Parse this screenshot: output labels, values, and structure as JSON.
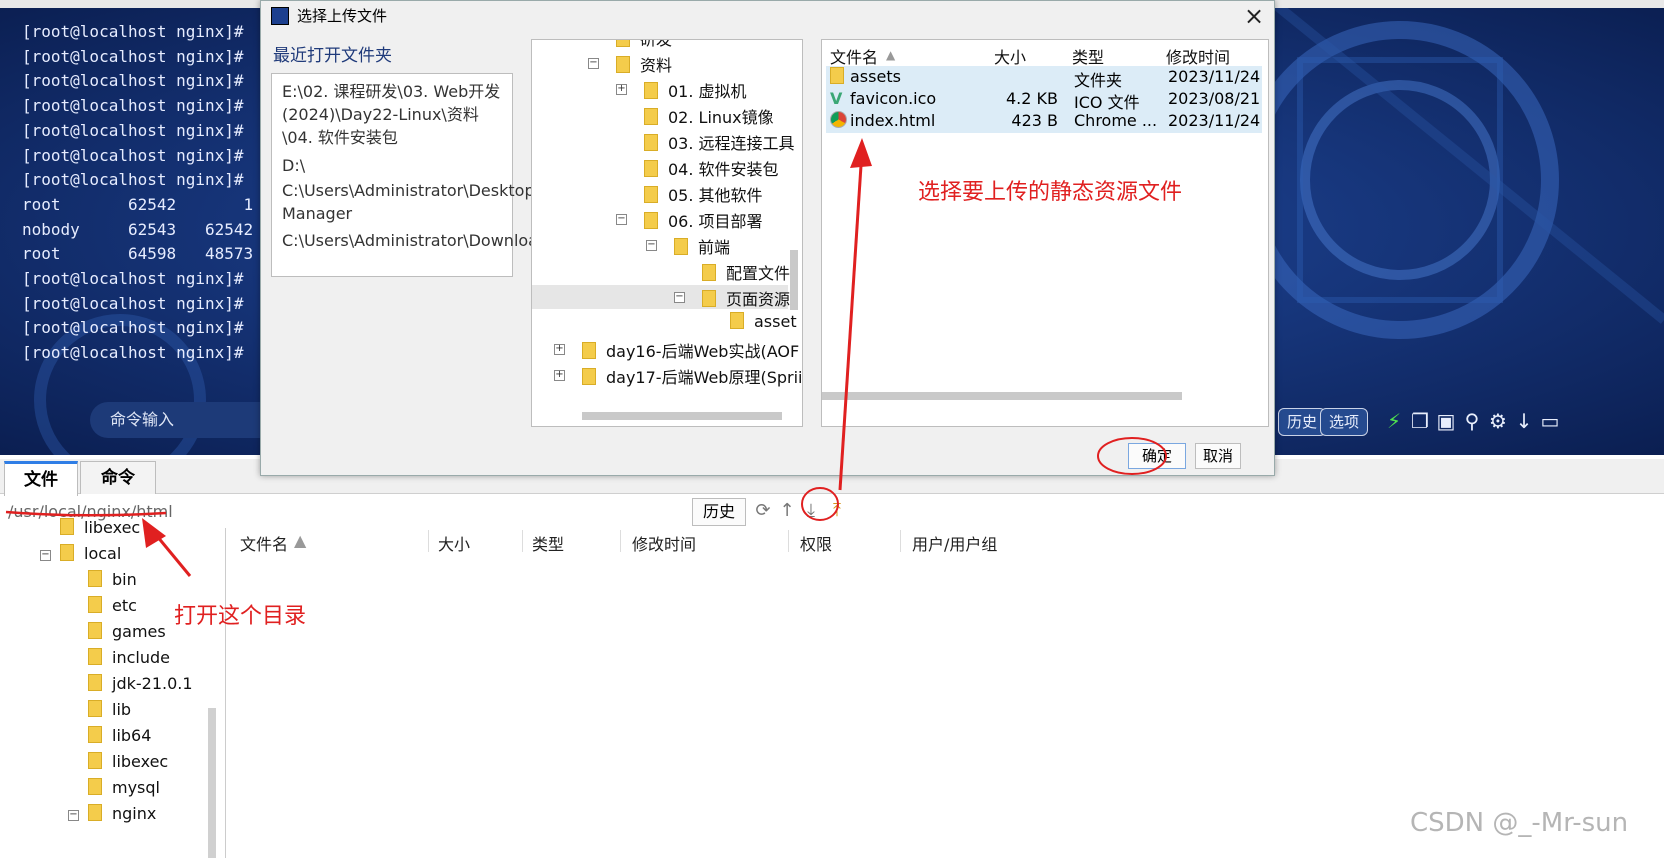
{
  "terminal": {
    "lines": [
      "[root@localhost nginx]#",
      "[root@localhost nginx]#",
      "[root@localhost nginx]#",
      "[root@localhost nginx]#",
      "[root@localhost nginx]#",
      "[root@localhost nginx]#",
      "[root@localhost nginx]#",
      "root       62542       1",
      "nobody     62543   62542",
      "root       64598   48573",
      "[root@localhost nginx]#",
      "[root@localhost nginx]#",
      "[root@localhost nginx]#",
      "[root@localhost nginx]#"
    ],
    "command_input_label": "命令输入",
    "toolbar": {
      "history_label": "历史",
      "options_label": "选项",
      "icons": [
        "lightning-icon",
        "copy-icon",
        "paste-icon",
        "search-icon",
        "gear-icon",
        "download-icon",
        "window-icon"
      ]
    }
  },
  "dialog": {
    "title": "选择上传文件",
    "recent_folders_label": "最近打开文件夹",
    "recent_folders": [
      "E:\\02. 课程研发\\03. Web开发(2024)\\Day22-Linux\\资料\\04. 软件安装包",
      "D:\\",
      "C:\\Users\\Administrator\\Desktop\\XH-Manager",
      "C:\\Users\\Administrator\\Downloads"
    ],
    "tree": [
      {
        "label": "研发",
        "indent": 0
      },
      {
        "label": "资料",
        "indent": 0,
        "expanded": true
      },
      {
        "label": "01. 虚拟机",
        "indent": 1,
        "expandable": true
      },
      {
        "label": "02. Linux镜像",
        "indent": 1
      },
      {
        "label": "03. 远程连接工具",
        "indent": 1
      },
      {
        "label": "04. 软件安装包",
        "indent": 1
      },
      {
        "label": "05. 其他软件",
        "indent": 1
      },
      {
        "label": "06. 项目部署",
        "indent": 1,
        "expanded": true
      },
      {
        "label": "前端",
        "indent": 2,
        "expanded": true
      },
      {
        "label": "配置文件",
        "indent": 3
      },
      {
        "label": "页面资源",
        "indent": 3,
        "expanded": true,
        "selected": true
      },
      {
        "label": "asset",
        "indent": 4
      },
      {
        "label": "day16-后端Web实战(AOF",
        "indent": -1,
        "expandable": true
      },
      {
        "label": "day17-后端Web原理(Sprii",
        "indent": -1,
        "expandable": true
      }
    ],
    "file_list": {
      "columns": [
        "文件名",
        "大小",
        "类型",
        "修改时间"
      ],
      "rows": [
        {
          "name": "assets",
          "size": "",
          "type": "文件夹",
          "modified": "2023/11/24",
          "icon": "folder-icon"
        },
        {
          "name": "favicon.ico",
          "size": "4.2 KB",
          "type": "ICO 文件",
          "modified": "2023/08/21",
          "icon": "vue-icon"
        },
        {
          "name": "index.html",
          "size": "423 B",
          "type": "Chrome ...",
          "modified": "2023/11/24",
          "icon": "chrome-icon"
        }
      ]
    },
    "ok_label": "确定",
    "cancel_label": "取消"
  },
  "bottom_panel": {
    "tabs": [
      "文件",
      "命令"
    ],
    "active_tab": 0,
    "path": "/usr/local/nginx/html",
    "history_label": "历史",
    "toolbar_icons": [
      "refresh-icon",
      "up-icon",
      "download-icon",
      "upload-icon"
    ],
    "tree": [
      {
        "label": "libexec",
        "indent": 0
      },
      {
        "label": "local",
        "indent": -1,
        "expanded": true
      },
      {
        "label": "bin",
        "indent": 1
      },
      {
        "label": "etc",
        "indent": 1
      },
      {
        "label": "games",
        "indent": 1
      },
      {
        "label": "include",
        "indent": 1
      },
      {
        "label": "jdk-21.0.1",
        "indent": 1
      },
      {
        "label": "lib",
        "indent": 1
      },
      {
        "label": "lib64",
        "indent": 1
      },
      {
        "label": "libexec",
        "indent": 1
      },
      {
        "label": "mysql",
        "indent": 1
      },
      {
        "label": "nginx",
        "indent": 1,
        "expanded": true
      }
    ],
    "file_columns": [
      "文件名",
      "大小",
      "类型",
      "修改时间",
      "权限",
      "用户/用户组"
    ]
  },
  "annotations": {
    "select_files": "选择要上传的静态资源文件",
    "open_dir": "打开这个目录"
  },
  "watermark": "CSDN @_-Mr-sun",
  "colors": {
    "annotation": "#e02020",
    "terminal_bg": "#0f2a6a",
    "accent": "#2f7ee6"
  }
}
